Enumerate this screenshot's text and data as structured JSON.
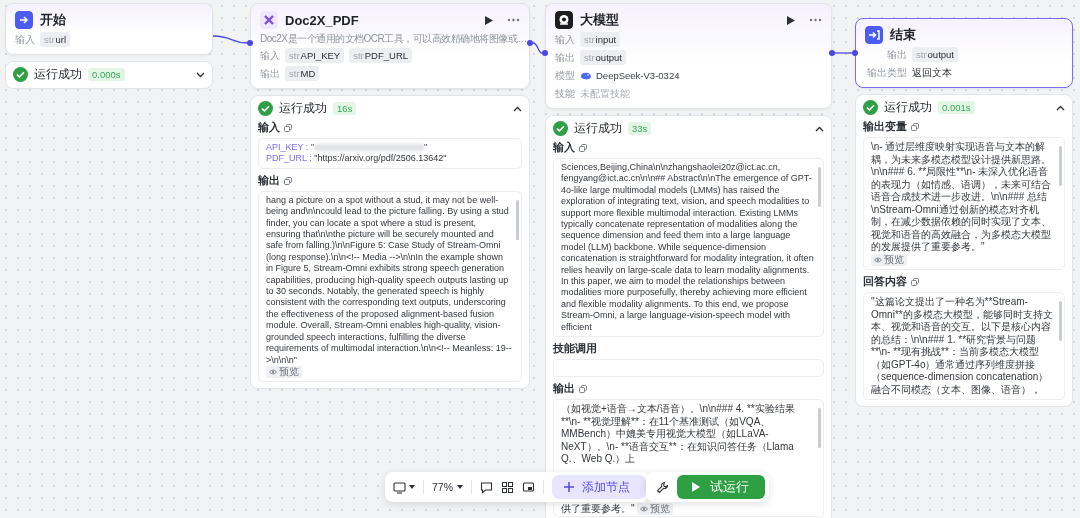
{
  "nodes": [
    {
      "kind": "start",
      "title": "开始",
      "selected": false,
      "fields": [
        {
          "label": "输入",
          "tags": [
            {
              "type": "str",
              "name": "url"
            }
          ]
        }
      ],
      "run": {
        "status": "运行成功",
        "time": "0.000s",
        "expanded": false
      }
    },
    {
      "kind": "plugin",
      "title": "Doc2X_PDF",
      "selected": false,
      "description": "Doc2X是一个通用的文档OCR工具，可以高效精确地将图像或…",
      "actions": true,
      "fields": [
        {
          "label": "输入",
          "tags": [
            {
              "type": "str",
              "name": "API_KEY"
            },
            {
              "type": "str",
              "name": "PDF_URL"
            }
          ]
        },
        {
          "label": "输出",
          "tags": [
            {
              "type": "str",
              "name": "MD"
            }
          ]
        }
      ],
      "run": {
        "status": "运行成功",
        "time": "16s",
        "expanded": true,
        "sections": [
          {
            "kind": "kv",
            "label": "输入",
            "copyable": true,
            "pairs": [
              {
                "key": "API_KEY :",
                "value": "\"",
                "redacted": true,
                "value_end": "\""
              },
              {
                "key": "PDF_URL :",
                "value": "\"https://arxiv.org/pdf/2506.13642\""
              }
            ]
          },
          {
            "kind": "text",
            "label": "输出",
            "copyable": true,
            "text": "hang a picture on a spot without a stud, it may not be well-being and\\n\\ncould lead to the picture falling. By using a stud finder, you can locate a spot where a stud is present, ensuring that\\n\\nthe picture will be securely mounted and safe from falling.)\\n\\nFigure 5: Case Study of Stream-Omni (long response).\\n\\n<!-- Media -->\\n\\nIn the example shown in Figure 5, Stream-Omni exhibits strong speech generation capabilities, producing high-quality speech outputs lasting up to 30 seconds. Notably, the generated speech is highly consistent with the corresponding text outputs, underscoring the effectiveness of the proposed alignment-based fusion module. Overall, Stream-Omni enables high-quality, vision-grounded speech interactions, fulfilling the diverse requirements of multimodal interaction.\\n\\n<!-- Meanless: 19-->\\n\\n\\n\"",
            "preview": "预览"
          }
        ]
      }
    },
    {
      "kind": "llm",
      "title": "大模型",
      "selected": false,
      "actions": true,
      "fields": [
        {
          "label": "输入",
          "tags": [
            {
              "type": "str",
              "name": "input"
            }
          ]
        },
        {
          "label": "输出",
          "tags": [
            {
              "type": "str",
              "name": "output"
            }
          ]
        },
        {
          "label": "模型",
          "model": "DeepSeek-V3-0324"
        },
        {
          "label": "技能",
          "value": "未配置技能",
          "muted": true
        }
      ],
      "run": {
        "status": "运行成功",
        "time": "33s",
        "expanded": true,
        "sections": [
          {
            "kind": "text",
            "label": "输入",
            "copyable": true,
            "text": "Sciences,Beijing,China\\n\\nzhangshaolei20z@ict.ac.cn, fengyang@ict.ac.cn\\n\\n## Abstract\\n\\nThe emergence of GPT-4o-like large multimodal models (LMMs) has raised the exploration of integrating text, vision, and speech modalities to support more flexible multimodal interaction. Existing LMMs typically concatenate representation of modalities along the sequence dimension and feed them into a large language model (LLM) backbone. While sequence-dimension concatenation is straightforward for modality integration, it often relies heavily on large-scale data to learn modality alignments. In this paper, we aim to model the relationships between modalities more purposefully, thereby achieving more efficient and flexible modality alignments. To this end, we propose Stream-Omni, a large language-vision-speech model with efficient"
          },
          {
            "kind": "empty",
            "label": "技能调用"
          },
          {
            "kind": "text",
            "label": "输出",
            "copyable": true,
            "text": "（如视觉+语音→文本/语音）。\\n\\n### 4. **实验结果**\\n- **视觉理解**：在11个基准测试（如VQA、MMBench）中媲美专用视觉大模型（如LLaVA-NeXT）。\\n- **语音交互**：在知识问答任务（Llama Q.、Web Q.）上",
            "preview": "预览",
            "tail": "供了重要参考。\""
          }
        ]
      }
    },
    {
      "kind": "end",
      "title": "结束",
      "selected": true,
      "fields": [
        {
          "label": "输出",
          "tags": [
            {
              "type": "str",
              "name": "output"
            }
          ]
        },
        {
          "label": "输出类型",
          "value": "返回文本"
        }
      ],
      "run": {
        "status": "运行成功",
        "time": "0.001s",
        "expanded": true,
        "sections": [
          {
            "kind": "text",
            "label": "输出变量",
            "copyable": true,
            "text": "\\n- 通过层维度映射实现语音与文本的解耦，为未来多模态模型设计提供新思路。\\n\\n### 6. **局限性**\\n- 未深入优化语音的表现力（如情感、语调），未来可结合语音合成技术进一步改进。\\n\\n### 总结\\nStream-Omni通过创新的模态对齐机制，在减少数据依赖的同时实现了文本、视觉和语音的高效融合，为多模态大模型的发展提供了重要参考。\"",
            "preview": "预览"
          },
          {
            "kind": "text",
            "label": "回答内容",
            "copyable": true,
            "text": "\"这篇论文提出了一种名为**Stream-Omni**的多模态大模型，能够同时支持文本、视觉和语音的交互。以下是核心内容的总结：\\n\\n### 1. **研究背景与问题**\\n- **现有挑战**：当前多模态大模型（如GPT-4o）通常通过序列维度拼接（sequence-dimension concatenation）融合不同模态（文本、图像、语音），"
          }
        ]
      }
    }
  ],
  "toolbar": {
    "zoom": "77%",
    "add_node": "添加节点",
    "run_button": "试运行"
  }
}
